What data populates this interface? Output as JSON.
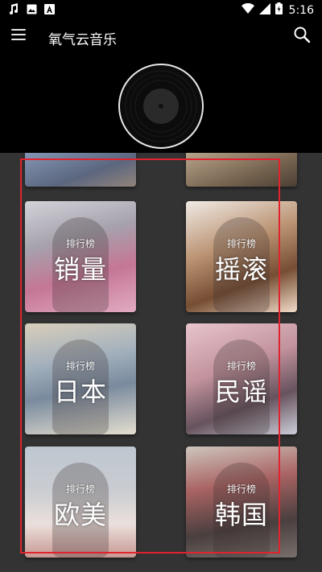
{
  "status_bar": {
    "time": "5:16",
    "left_icons": [
      "music-note-icon",
      "image-icon",
      "a-letter-icon"
    ],
    "right_icons": [
      "wifi-icon",
      "signal-icon",
      "battery-icon"
    ]
  },
  "app_bar": {
    "title": "氧气云音乐",
    "menu_icon": "hamburger-menu-icon",
    "search_icon": "search-icon"
  },
  "chart_cards": [
    {
      "subtitle": "排行榜",
      "title": "销量"
    },
    {
      "subtitle": "排行榜",
      "title": "摇滚"
    },
    {
      "subtitle": "排行榜",
      "title": "日本"
    },
    {
      "subtitle": "排行榜",
      "title": "民谣"
    },
    {
      "subtitle": "排行榜",
      "title": "欧美"
    },
    {
      "subtitle": "排行榜",
      "title": "韩国"
    }
  ],
  "colors": {
    "header_bg": "#000000",
    "content_bg": "#333333",
    "highlight": "#e0232e"
  }
}
